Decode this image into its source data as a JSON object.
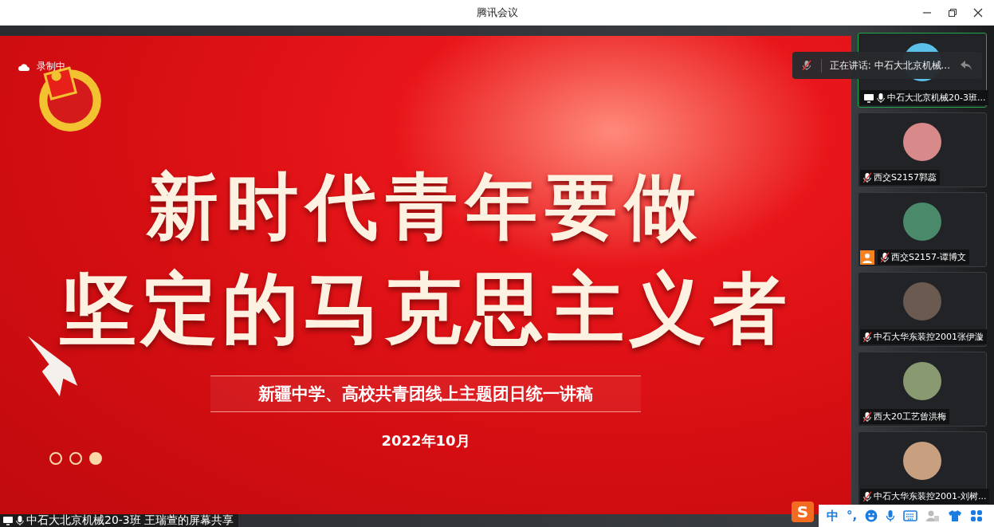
{
  "window": {
    "title": "腾讯会议"
  },
  "recording": {
    "label": "录制中"
  },
  "speaking_toast": {
    "text": "正在讲话: 中石大北京机械..."
  },
  "slide": {
    "title_lines": [
      "新时代青年要做",
      "坚定的马克思主义者"
    ],
    "subtitle": "新疆中学、高校共青团线上主题团日统一讲稿",
    "date": "2022年10月",
    "pager": [
      {
        "selected": false
      },
      {
        "selected": false
      },
      {
        "selected": true
      }
    ]
  },
  "participants": [
    {
      "name": "中石大北京机械20-3班...",
      "muted": false,
      "sharing": true,
      "host": false,
      "active": true
    },
    {
      "name": "西交S2157郭蕊",
      "muted": true,
      "sharing": false,
      "host": false,
      "active": false
    },
    {
      "name": "西交S2157-谭博文",
      "muted": true,
      "sharing": false,
      "host": true,
      "active": false
    },
    {
      "name": "中石大华东装控2001张伊漩",
      "muted": true,
      "sharing": false,
      "host": false,
      "active": false
    },
    {
      "name": "西大20工艺曾洪梅",
      "muted": true,
      "sharing": false,
      "host": false,
      "active": false
    },
    {
      "name": "中石大华东装控2001-刘树...",
      "muted": true,
      "sharing": false,
      "host": false,
      "active": false
    }
  ],
  "status_bar": {
    "label": "中石大北京机械20-3班 王瑞萱的屏幕共享",
    "muted": false
  },
  "ime_bar": {
    "logo": "S",
    "mode": "中",
    "punctuation": "°,"
  }
}
